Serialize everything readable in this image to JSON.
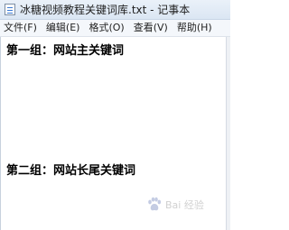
{
  "window": {
    "title": "冰糖视频教程关键词库.txt - 记事本"
  },
  "menu": [
    {
      "label": "文件(F)"
    },
    {
      "label": "编辑(E)"
    },
    {
      "label": "格式(O)"
    },
    {
      "label": "查看(V)"
    },
    {
      "label": "帮助(H)"
    }
  ],
  "editor": {
    "lines": [
      "第一组：网站主关键词",
      "第二组：网站长尾关键词"
    ]
  },
  "watermark": {
    "text": "Bai 经验"
  },
  "icons": {
    "app": "notepad-icon",
    "watermark": "paw-icon"
  }
}
